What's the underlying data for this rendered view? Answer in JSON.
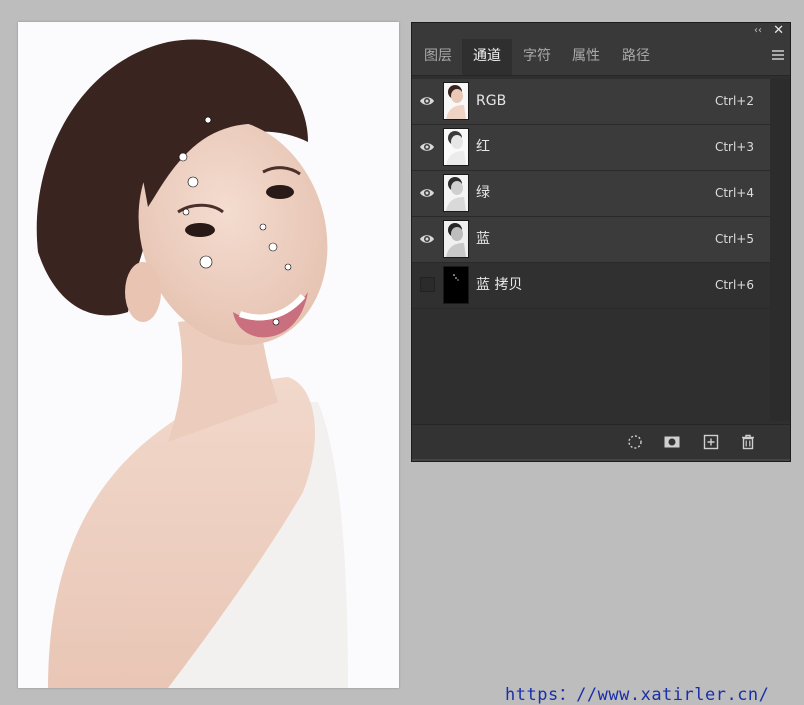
{
  "panel": {
    "collapse_icon": "double-chevron-left-icon",
    "close_icon": "close-icon",
    "tabs": [
      {
        "label": "图层",
        "active": false
      },
      {
        "label": "通道",
        "active": true
      },
      {
        "label": "字符",
        "active": false
      },
      {
        "label": "属性",
        "active": false
      },
      {
        "label": "路径",
        "active": false
      }
    ],
    "menu_icon": "hamburger-menu-icon",
    "channels": [
      {
        "name": "RGB",
        "shortcut": "Ctrl+2",
        "visible": true
      },
      {
        "name": "红",
        "shortcut": "Ctrl+3",
        "visible": true
      },
      {
        "name": "绿",
        "shortcut": "Ctrl+4",
        "visible": true
      },
      {
        "name": "蓝",
        "shortcut": "Ctrl+5",
        "visible": true
      },
      {
        "name": "蓝 拷贝",
        "shortcut": "Ctrl+6",
        "visible": false
      }
    ],
    "bottom_buttons": [
      "load-selection-icon",
      "save-selection-mask-icon",
      "new-channel-icon",
      "delete-channel-icon"
    ]
  },
  "watermark": "https：//www.xatirler.cn/",
  "colors": {
    "background": "#bdbdbd",
    "panel_bg": "#2f2f2f",
    "row_bg": "#3b3b3b",
    "watermark": "#1a2fa8"
  }
}
